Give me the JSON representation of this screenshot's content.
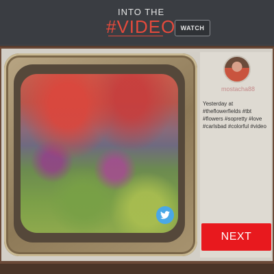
{
  "header": {
    "title_line1": "INTO THE",
    "title_line2": "#VIDEO",
    "watch_label": "WATCH"
  },
  "post": {
    "username": "mostacha88",
    "text": "Yesterday at\n#theflowerfields #tbt\n#flowers #sopretty #love\n#carlsbad #colorful #video"
  },
  "actions": {
    "next_label": "NEXT"
  },
  "icons": {
    "share": "twitter-icon"
  },
  "colors": {
    "accent": "#e64a3c",
    "next_button": "#e8191e",
    "twitter": "#4aa8e6",
    "header_bg": "#3a3d42"
  }
}
